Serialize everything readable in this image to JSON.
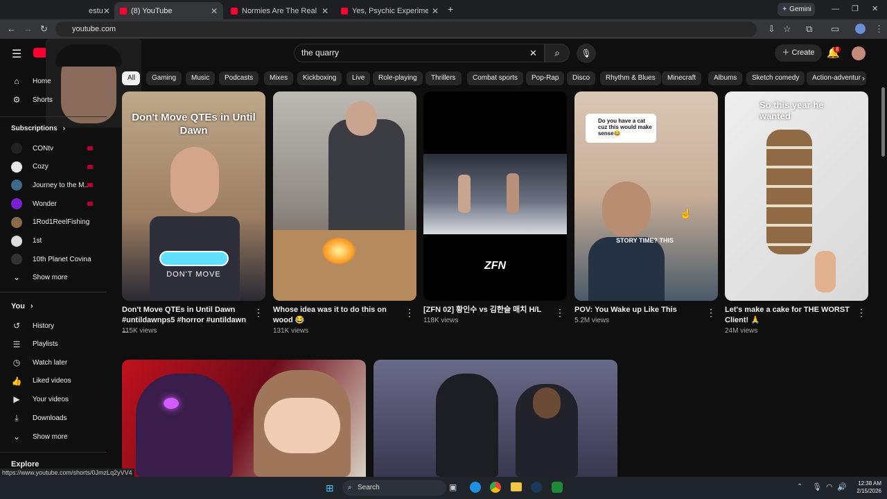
{
  "browser": {
    "tabs": [
      {
        "label": "estu"
      },
      {
        "label": "(8) YouTube"
      },
      {
        "label": "Normies Are The Real Schizos"
      },
      {
        "label": "Yes, Psychic Experiments Still H"
      }
    ],
    "new_tab": "+",
    "gemini_label": "Gemini",
    "url": "youtube.com",
    "status_url": "https://www.youtube.com/shorts/0JmzLq2yVV4"
  },
  "header": {
    "logo_letter": "Y",
    "search_value": "the quarry",
    "create_label": "Create",
    "notification_count": "8"
  },
  "chips": [
    "All",
    "Gaming",
    "Music",
    "Podcasts",
    "Mixes",
    "Kickboxing",
    "Live",
    "Role-playing",
    "Thrillers",
    "Combat sports",
    "Pop-Rap",
    "Disco",
    "Rhythm & Blues",
    "Minecraft",
    "Albums",
    "Sketch comedy",
    "Action-adventur"
  ],
  "sidebar": {
    "home": "Home",
    "shorts": "Shorts",
    "subscriptions_title": "Subscriptions",
    "subscriptions": [
      {
        "label": "CONtv",
        "color": "#222222"
      },
      {
        "label": "Cozy",
        "color": "#e8e8e8"
      },
      {
        "label": "Journey to the M...",
        "color": "#3d6b8a"
      },
      {
        "label": "Wonder",
        "color": "#7a1fd1"
      },
      {
        "label": "1Rod1ReelFishing",
        "color": "#8a6a4a"
      },
      {
        "label": "1st",
        "color": "#dddddd"
      },
      {
        "label": "10th Planet Covina",
        "color": "#333333"
      }
    ],
    "show_more": "Show more",
    "you_title": "You",
    "you_items": [
      {
        "label": "History",
        "icon": "history-icon"
      },
      {
        "label": "Playlists",
        "icon": "playlists-icon"
      },
      {
        "label": "Watch later",
        "icon": "watch-later-icon"
      },
      {
        "label": "Liked videos",
        "icon": "liked-icon"
      },
      {
        "label": "Your videos",
        "icon": "your-videos-icon"
      },
      {
        "label": "Downloads",
        "icon": "downloads-icon"
      }
    ],
    "show_more_2": "Show more",
    "explore_title": "Explore"
  },
  "shorts": [
    {
      "title": "Don't Move QTEs in Until Dawn #untildawnps5 #horror #untildawn ...",
      "views": "115K views",
      "overlay_top": "Don't Move QTEs in Until Dawn",
      "overlay_bottom": "DON'T MOVE"
    },
    {
      "title": "Whose idea was it to do this on wood 😂",
      "views": "131K views"
    },
    {
      "title": "[ZFN 02] 황인수 vs 김한슬 매치 H/L",
      "views": "118K views",
      "overlay": "ZFN"
    },
    {
      "title": "POV: You Wake up Like This",
      "views": "5.2M views",
      "comment": "Do you have a cat cuz this would make sense😂",
      "overlay": "STORY TIME? THIS"
    },
    {
      "title": "Let's make a cake for THE WORST Client! 🙏",
      "views": "24M views",
      "overlay": "So this year he wanted"
    }
  ],
  "taskbar": {
    "search_label": "Search",
    "time": "12:38 AM",
    "date": "2/15/2026"
  },
  "colors": {
    "youtube_red": "#ff0033",
    "background": "#0f0f0f",
    "chip_bg": "#272727"
  }
}
